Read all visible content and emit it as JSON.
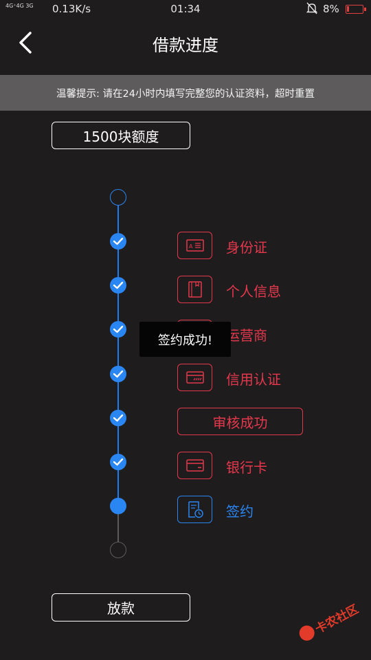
{
  "status_bar": {
    "network": "4G⁺4G  3G",
    "speed": "0.13K/s",
    "time": "01:34",
    "battery": "8%"
  },
  "header": {
    "title": "借款进度"
  },
  "notice": {
    "text": "温馨提示: 请在24小时内填写完整您的认证资料，超时重置"
  },
  "quota": {
    "label": "1500块额度"
  },
  "steps": [
    {
      "label": "身份证",
      "icon": "id-card-icon",
      "status": "done"
    },
    {
      "label": "个人信息",
      "icon": "notebook-icon",
      "status": "done"
    },
    {
      "label": "运营商",
      "icon": "phone-icon",
      "status": "done"
    },
    {
      "label": "信用认证",
      "icon": "credit-card-icon",
      "status": "done"
    },
    {
      "label": "审核成功",
      "icon": "",
      "status": "done"
    },
    {
      "label": "银行卡",
      "icon": "bank-card-icon",
      "status": "done"
    },
    {
      "label": "签约",
      "icon": "contract-clock-icon",
      "status": "current"
    }
  ],
  "toast": {
    "text": "签约成功!"
  },
  "actions": {
    "loan_label": "放款"
  },
  "watermark": {
    "text": "卡农社区"
  },
  "colors": {
    "background": "#1f1c1e",
    "accent_red": "#e5384c",
    "accent_blue": "#2a86f2"
  }
}
